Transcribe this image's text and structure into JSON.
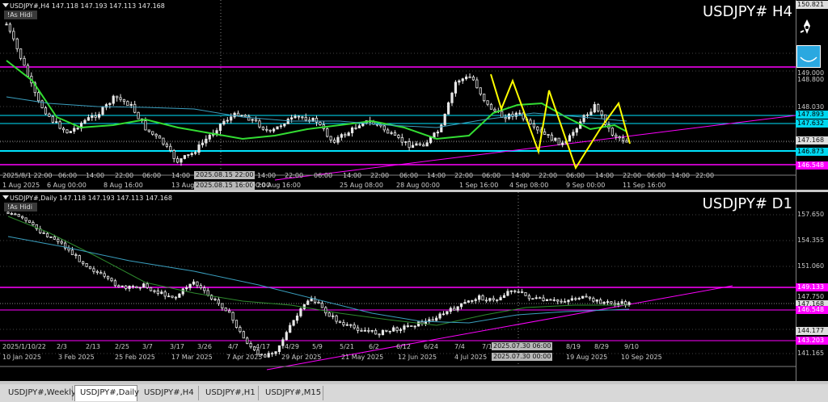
{
  "h4": {
    "symbol_line": "USDJPY#,H4  147.118 147.193 147.113 147.168",
    "as_hidi": "!As Hidi",
    "title": "USDJPY#  H4",
    "price_labels": [
      "150.821",
      "149.000",
      "148.800",
      "148.030",
      "147.893",
      "147.632",
      "147.168",
      "146.873",
      "146.548"
    ],
    "time_labels": [
      "2025/8/1 22:00",
      "06:00",
      "14:00",
      "22:00",
      "06:00",
      "14:00",
      "22:00",
      "06:00",
      "14:00",
      "22:00",
      "06:00",
      "14:00",
      "22:00",
      "06:00",
      "14:00",
      "22:00",
      "06:00",
      "14:00",
      "22:00",
      "06:00",
      "14:00",
      "22:00",
      "06:00",
      "14:00",
      "22:00"
    ],
    "date_labels": [
      "1 Aug 2025",
      "6 Aug 00:00",
      "8 Aug 16:00",
      "13 Aug",
      "20 Aug 16:00",
      "25 Aug 08:00",
      "28 Aug 00:00",
      "1 Sep 16:00",
      "4 Sep 08:00",
      "9 Sep 00:00",
      "11 Sep 16:00"
    ],
    "crosshair_labels": [
      "2025.08.15 22:00",
      "2025.08.15 16:00",
      "00:00"
    ]
  },
  "d1": {
    "symbol_line": "USDJPY#,Daily  147.118 147.193 147.113 147.168",
    "as_hidi": "!As Hidi",
    "title": "USDJPY#  D1",
    "price_labels": [
      "157.650",
      "154.355",
      "151.060",
      "149.133",
      "147.750",
      "147.168",
      "146.548",
      "144.177",
      "143.203",
      "141.165"
    ],
    "time_labels": [
      "2025/1/10/22",
      "2/3",
      "2/13",
      "2/25",
      "3/7",
      "3/17",
      "3/26",
      "4/7",
      "4/17",
      "4/29",
      "5/9",
      "5/21",
      "6/2",
      "6/12",
      "6/24",
      "7/4",
      "7/1",
      "7",
      "8/19",
      "8/29",
      "9/10"
    ],
    "date_labels": [
      "10 Jan 2025",
      "3 Feb 2025",
      "25 Feb 2025",
      "17 Mar 2025",
      "7 Apr 2025",
      "29 Apr 2025",
      "21 May 2025",
      "12 Jun 2025",
      "4 Jul 2025",
      "19 Aug 2025",
      "10 Sep 2025"
    ],
    "crosshair_labels": [
      "2025.07.30 06:00",
      "2025.07.30 00:00"
    ]
  },
  "tabs": [
    {
      "label": "USDJPY#,Weekly",
      "active": false
    },
    {
      "label": "USDJPY#,Daily",
      "active": true
    },
    {
      "label": "USDJPY#,H4",
      "active": false
    },
    {
      "label": "USDJPY#,H1",
      "active": false
    },
    {
      "label": "USDJPY#,M15",
      "active": false
    }
  ],
  "colors": {
    "magenta": "#ff00ff",
    "cyan": "#00e5ff",
    "green_ma": "#33dd33",
    "blue_ma": "#3a9fbf",
    "yellow": "#ffff00",
    "candle": "#e8e8e8"
  },
  "icons": [
    "pen-tool-icon",
    "indicator-icon"
  ]
}
